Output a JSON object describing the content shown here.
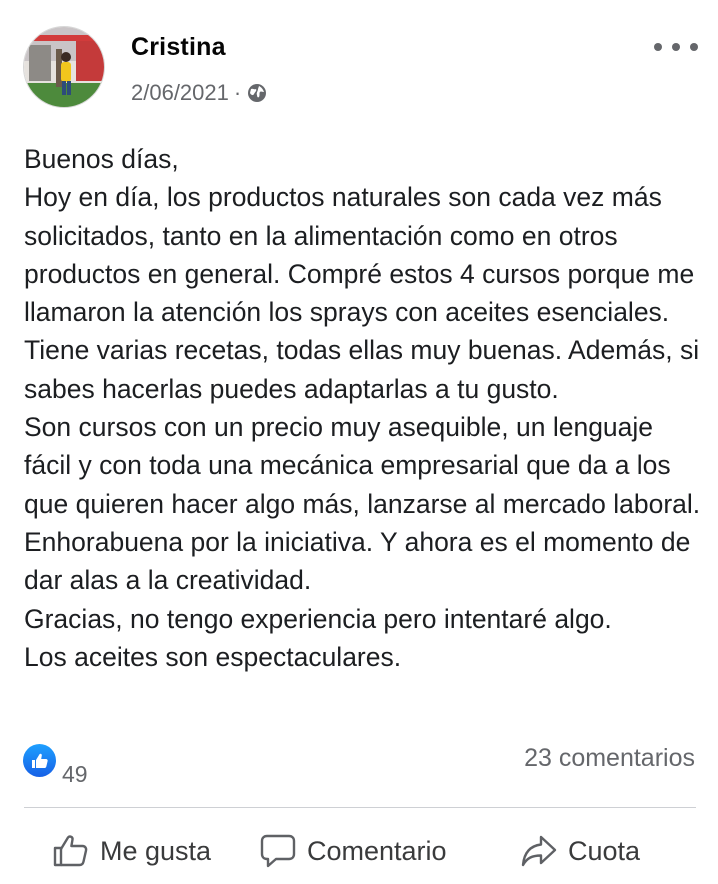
{
  "post": {
    "author": "Cristina",
    "date": "2/06/2021",
    "separator": "·",
    "privacy_icon": "globe-icon",
    "more_icon": "more-options-icon",
    "text_paragraphs": [
      "Buenos días,",
      "Hoy en día, los productos naturales son cada vez más solicitados, tanto en la alimentación como en otros productos en general. Compré estos 4 cursos porque me llamaron la atención los sprays con aceites esenciales. Tiene varias recetas, todas ellas muy buenas. Además, si sabes hacerlas puedes adaptarlas a tu gusto.",
      "Son cursos con un precio muy asequible, un lenguaje fácil y con toda una mecánica empresarial que da a los que quieren hacer algo más, lanzarse al mercado laboral. Enhorabuena por la iniciativa. Y ahora es el momento de dar alas a la creatividad.",
      "Gracias, no tengo experiencia pero intentaré algo.",
      "Los aceites son espectaculares."
    ],
    "reactions": {
      "icon": "like-reaction-icon",
      "count": "49"
    },
    "comments_label": "23 comentarios"
  },
  "actions": {
    "like_label": "Me gusta",
    "comment_label": "Comentario",
    "share_label": "Cuota"
  },
  "colors": {
    "like_blue": "#1877f2",
    "secondary_text": "#65676b",
    "primary_text": "#050505"
  }
}
